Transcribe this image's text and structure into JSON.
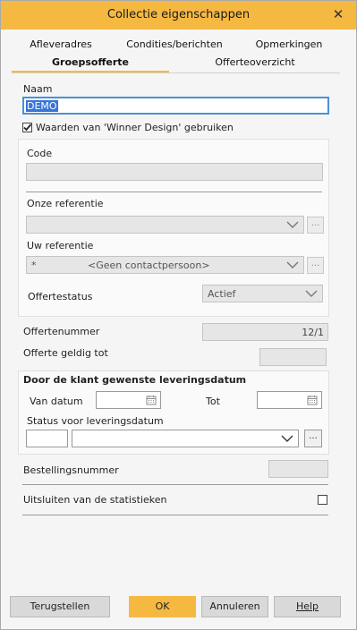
{
  "window": {
    "title": "Collectie eigenschappen"
  },
  "tabs": [
    "Afleveradres",
    "Condities/berichten",
    "Opmerkingen",
    "Groepsofferte",
    "Offerteoverzicht"
  ],
  "active_tab": "Groepsofferte",
  "naam": {
    "label": "Naam",
    "value": "DEMO"
  },
  "winner_checkbox": {
    "label": "Waarden van 'Winner Design' gebruiken",
    "checked": true
  },
  "code": {
    "label": "Code",
    "value": ""
  },
  "onze_referentie": {
    "label": "Onze referentie",
    "value": ""
  },
  "uw_referentie": {
    "label": "Uw referentie",
    "prefix": "*",
    "value": "<Geen contactpersoon>"
  },
  "offertestatus": {
    "label": "Offertestatus",
    "value": "Actief"
  },
  "offertenummer": {
    "label": "Offertenummer",
    "value": "12/1"
  },
  "offerte_geldig": {
    "label": "Offerte geldig tot",
    "value": ""
  },
  "leveringsdatum": {
    "title": "Door de klant gewenste leveringsdatum",
    "van_label": "Van datum",
    "tot_label": "Tot",
    "status_label": "Status voor leveringsdatum"
  },
  "bestellingsnummer": {
    "label": "Bestellingsnummer",
    "value": ""
  },
  "uitsluiten": {
    "label": "Uitsluiten van de statistieken",
    "checked": false
  },
  "buttons": {
    "reset": "Terugstellen",
    "ok": "OK",
    "cancel": "Annuleren",
    "help": "Help"
  },
  "dots_label": "...",
  "colors": {
    "accent": "#f5b942",
    "focus": "#4a90d9"
  }
}
